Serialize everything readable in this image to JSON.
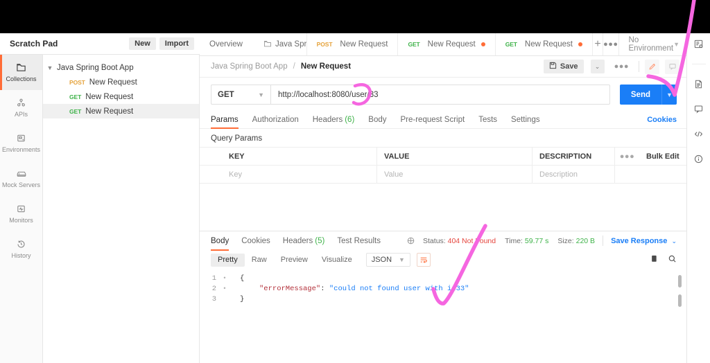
{
  "app": {
    "workspace_title": "Scratch Pad",
    "new_button": "New",
    "import_button": "Import"
  },
  "rail": {
    "items": [
      {
        "label": "Collections",
        "icon": "collections-icon",
        "active": true
      },
      {
        "label": "APIs",
        "icon": "apis-icon",
        "active": false
      },
      {
        "label": "Environments",
        "icon": "environments-icon",
        "active": false
      },
      {
        "label": "Mock Servers",
        "icon": "mock-servers-icon",
        "active": false
      },
      {
        "label": "Monitors",
        "icon": "monitors-icon",
        "active": false
      },
      {
        "label": "History",
        "icon": "history-icon",
        "active": false
      }
    ]
  },
  "sidebar": {
    "filter_placeholder": "",
    "more_label": "●●●",
    "collection": {
      "name": "Java Spring Boot App",
      "expanded": true,
      "requests": [
        {
          "method": "POST",
          "name": "New Request",
          "selected": false
        },
        {
          "method": "GET",
          "name": "New Request",
          "selected": false
        },
        {
          "method": "GET",
          "name": "New Request",
          "selected": true
        }
      ]
    }
  },
  "tabstrip": {
    "overview": "Overview",
    "tabs": [
      {
        "icon": "collection-icon",
        "method": "",
        "label": "Java Spring Boot",
        "dirty": false
      },
      {
        "icon": "",
        "method": "POST",
        "label": "New Request",
        "dirty": false
      },
      {
        "icon": "",
        "method": "GET",
        "label": "New Request",
        "dirty": true
      },
      {
        "icon": "",
        "method": "GET",
        "label": "New Request",
        "dirty": true
      }
    ],
    "plus_label": "+",
    "more_label": "●●●",
    "environment": "No Environment"
  },
  "breadcrumb": {
    "collection": "Java Spring Boot App",
    "separator": "/",
    "current": "New Request",
    "save_label": "Save",
    "save_caret": "⌄",
    "more_label": "●●●"
  },
  "request": {
    "method": "GET",
    "url": "http://localhost:8080/user/33",
    "send_label": "Send",
    "tabs": [
      {
        "label": "Params",
        "count": "",
        "active": true
      },
      {
        "label": "Authorization",
        "count": "",
        "active": false
      },
      {
        "label": "Headers",
        "count": "(6)",
        "active": false
      },
      {
        "label": "Body",
        "count": "",
        "active": false
      },
      {
        "label": "Pre-request Script",
        "count": "",
        "active": false
      },
      {
        "label": "Tests",
        "count": "",
        "active": false
      },
      {
        "label": "Settings",
        "count": "",
        "active": false
      }
    ],
    "cookies_link": "Cookies",
    "query_params_title": "Query Params",
    "params_table": {
      "headers": [
        "KEY",
        "VALUE",
        "DESCRIPTION"
      ],
      "dots_label": "●●●",
      "bulk_edit_label": "Bulk Edit",
      "rows": [
        {
          "key": "Key",
          "value": "Value",
          "description": "Description"
        }
      ]
    }
  },
  "response": {
    "tabs": [
      {
        "label": "Body",
        "count": "",
        "active": true
      },
      {
        "label": "Cookies",
        "count": "",
        "active": false
      },
      {
        "label": "Headers",
        "count": "(5)",
        "active": false
      },
      {
        "label": "Test Results",
        "count": "",
        "active": false
      }
    ],
    "status_label": "Status:",
    "status_value": "404 Not Found",
    "time_label": "Time:",
    "time_value": "59.77 s",
    "size_label": "Size:",
    "size_value": "220 B",
    "save_response_label": "Save Response",
    "save_response_caret": "⌄",
    "view_modes": [
      {
        "label": "Pretty",
        "active": true
      },
      {
        "label": "Raw",
        "active": false
      },
      {
        "label": "Preview",
        "active": false
      },
      {
        "label": "Visualize",
        "active": false
      }
    ],
    "format": "JSON",
    "body": {
      "lines": [
        {
          "num": "1",
          "fold": "•",
          "open_brace": "{",
          "key": "",
          "colon": "",
          "value": ""
        },
        {
          "num": "2",
          "fold": "",
          "open_brace": "",
          "key": "\"errorMessage\"",
          "colon": ":",
          "value": "\"could not found user with id33\""
        },
        {
          "num": "3",
          "fold": "•",
          "open_brace": "}",
          "key": "",
          "colon": "",
          "value": ""
        }
      ]
    }
  },
  "right_rail": {
    "items": [
      {
        "icon": "environment-quick-look-icon"
      },
      {
        "icon": "documentation-icon"
      },
      {
        "icon": "comments-icon"
      },
      {
        "icon": "code-snippet-icon"
      },
      {
        "icon": "info-icon"
      }
    ]
  },
  "colors": {
    "accent_orange": "#ff6c37",
    "send_blue": "#1a7ef7",
    "get_green": "#3db248",
    "post_orange": "#e5a33c",
    "error_red": "#e5443c",
    "annotation_pink": "#f566e0"
  }
}
